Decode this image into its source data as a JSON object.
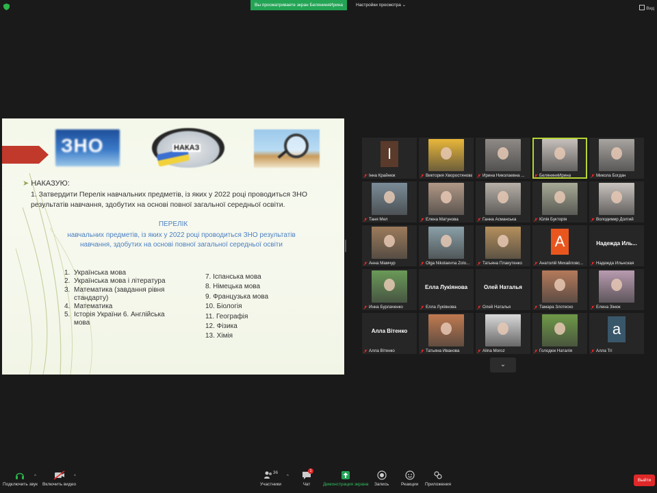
{
  "top": {
    "banner": "Вы просматриваете экран БеляниняИрина",
    "view_settings": "Настройки просмотра",
    "view_button": "Вид"
  },
  "slide": {
    "heading": "НАКАЗУЮ:",
    "order_text": "1. Затвердити Перелік навчальних предметів, із яких у 2022 році проводиться ЗНО результатів навчання, здобутих на основі повної загальної середньої освіти.",
    "list_title": "ПЕРЕЛІК",
    "list_subtitle": "навчальних предметів, із яких у 2022 році проводиться ЗНО результатів навчання, здобутих на основі повної загальної середньої освіти",
    "logo_zno": "ЗНО",
    "logo_nakaz": "НАКАЗ",
    "subjects_left": [
      {
        "num": "1.",
        "text": "Українська мова"
      },
      {
        "num": "2.",
        "text": "Українська мова і література"
      },
      {
        "num": "3.",
        "text": "Математика (завдання рівня стандарту)"
      },
      {
        "num": "4.",
        "text": "Математика"
      },
      {
        "num": "5.",
        "text": "Історія України 6. Англійська мова"
      }
    ],
    "subjects_right": [
      "7. Іспанська мова",
      "8. Німецька мова",
      "9. Французька мова",
      "10. Біологія",
      "11. Географія",
      "12. Фізика",
      "13. Хімія"
    ]
  },
  "participants": [
    {
      "name": "Інна Крайнюк",
      "kind": "letter",
      "letter": "I",
      "color": "#5a3a2a"
    },
    {
      "name": "Виктория Хворостянова",
      "kind": "photo",
      "color": "#e9b73a"
    },
    {
      "name": "Ирина Николаевна ...",
      "kind": "photo",
      "color": "#8f8a86"
    },
    {
      "name": "БеляниняИрина",
      "kind": "photo",
      "color": "#c6c0bb",
      "active": true
    },
    {
      "name": "Микола Богдан",
      "kind": "photo",
      "color": "#a8a4a0"
    },
    {
      "name": "Таня Мел",
      "kind": "photo",
      "color": "#7a8c98"
    },
    {
      "name": "Елена Матунова",
      "kind": "photo",
      "color": "#b19886"
    },
    {
      "name": "Ганна Асманська",
      "kind": "photo",
      "color": "#b7b0a8"
    },
    {
      "name": "Юлія Букторія",
      "kind": "photo",
      "color": "#a7aa96"
    },
    {
      "name": "Володимир Долгий",
      "kind": "photo",
      "color": "#c9c3be"
    },
    {
      "name": "Анна Мамчур",
      "kind": "photo",
      "color": "#9c7b5b"
    },
    {
      "name": "Olga Nikolaevna Zolo...",
      "kind": "photo",
      "color": "#8aa0a8"
    },
    {
      "name": "Татьяна Плакутенко",
      "kind": "photo",
      "color": "#b5905d"
    },
    {
      "name": "Анатолій Михайловс...",
      "kind": "letter",
      "letter": "A",
      "color": "#e8561e"
    },
    {
      "name": "Надежда Ильнская",
      "kind": "text",
      "bigname": "Надежда  Иль..."
    },
    {
      "name": "Инна Бурлаченко",
      "kind": "photo",
      "color": "#6a9a58"
    },
    {
      "name": "Елла Лукіянова",
      "kind": "text",
      "bigname": "Елла Лукіянова"
    },
    {
      "name": "Олей Наталья",
      "kind": "text",
      "bigname": "Олей Наталья"
    },
    {
      "name": "Тамара Злотеско",
      "kind": "photo",
      "color": "#b57a5b"
    },
    {
      "name": "Елена Зінюк",
      "kind": "photo",
      "color": "#b89bb0"
    },
    {
      "name": "Алла Вітенко",
      "kind": "text",
      "bigname": "Алла Вітенко"
    },
    {
      "name": "Татьяна Иванова",
      "kind": "photo",
      "color": "#c07a50"
    },
    {
      "name": "Alina Moroz",
      "kind": "photo",
      "color": "#d9d9d9"
    },
    {
      "name": "Голодюк Наталія",
      "kind": "photo",
      "color": "#6f9a48"
    },
    {
      "name": "Алла Tri",
      "kind": "letter",
      "letter": "a",
      "color": "#39576a"
    }
  ],
  "toolbar": {
    "audio": "Подключить звук",
    "video": "Включить видео",
    "participants": "Участники",
    "participants_count": "36",
    "chat": "Чат",
    "chat_badge": "1",
    "share": "Демонстрация экрана",
    "record": "Запись",
    "reactions": "Реакции",
    "apps": "Приложения",
    "leave": "Выйти"
  },
  "colors": {
    "banner_green": "#23a455",
    "active_outline": "#b6d733",
    "leave_red": "#e02828",
    "slide_blue_text": "#4a7fc1"
  }
}
